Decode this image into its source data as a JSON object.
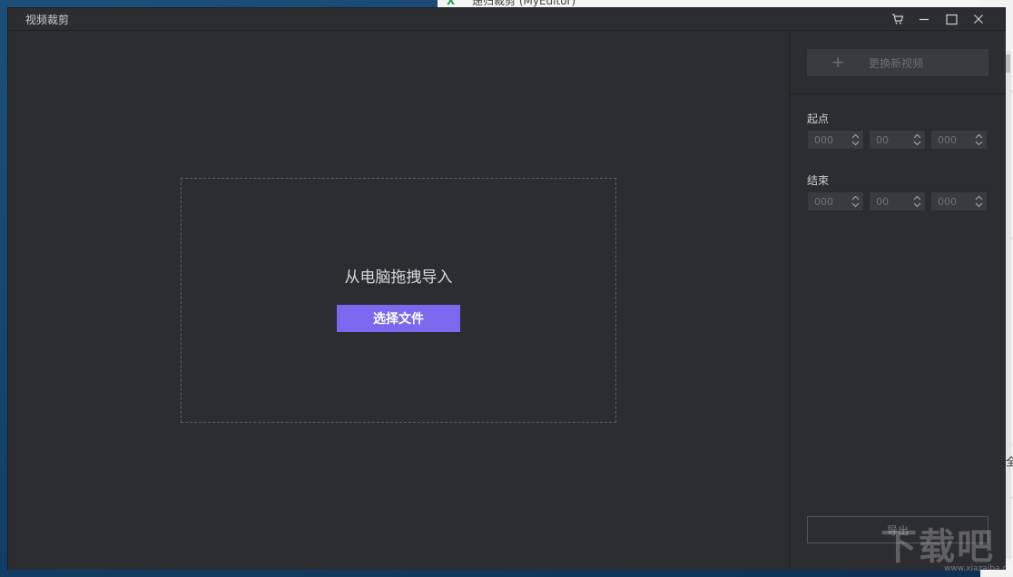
{
  "window": {
    "title": "视频裁剪"
  },
  "background": {
    "other_window_title": "递归裁剪 (MyEditor)",
    "fragment_text": "全",
    "watermark": "下载吧",
    "watermark_url": "www.xiazaiba.com"
  },
  "dropzone": {
    "hint": "从电脑拖拽导入",
    "select_label": "选择文件"
  },
  "sidebar": {
    "replace_label": "更换新视频",
    "start": {
      "label": "起点",
      "fields": [
        "000",
        "00",
        "000"
      ]
    },
    "end": {
      "label": "结束",
      "fields": [
        "000",
        "00",
        "000"
      ]
    },
    "export_label": "导出"
  },
  "colors": {
    "accent": "#7b68ee",
    "window_bg": "#2c2d30",
    "field_bg": "#3a3b3f"
  },
  "icons": {
    "cart": "cart-icon",
    "minimize": "minimize-icon",
    "maximize": "maximize-icon",
    "close": "close-icon",
    "plus": "plus-icon",
    "spinner": "spinner-arrows-icon"
  }
}
